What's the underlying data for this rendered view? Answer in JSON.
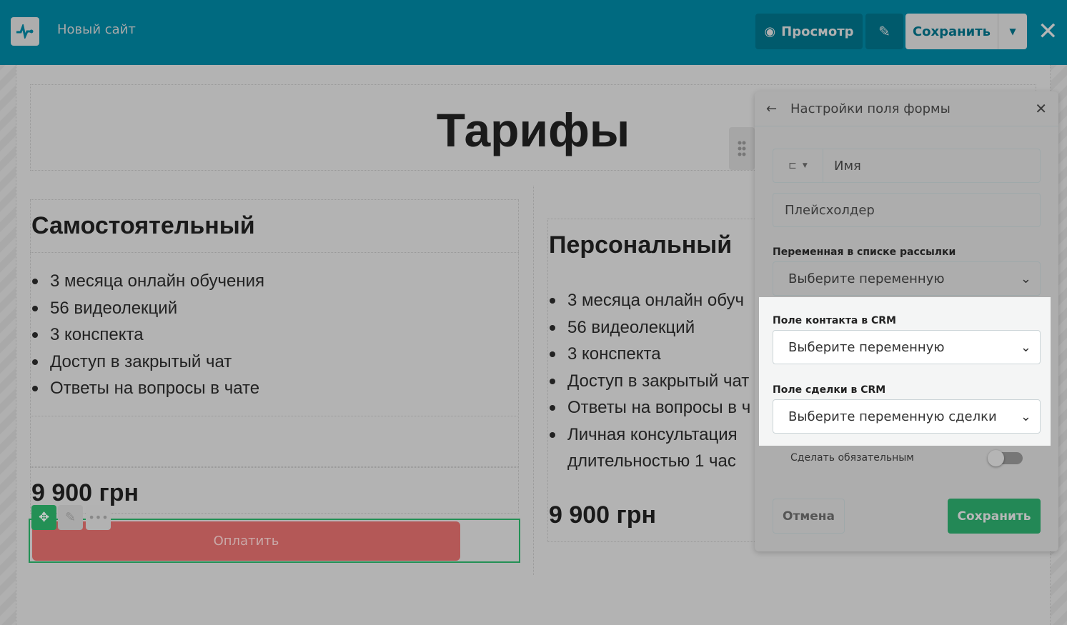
{
  "header": {
    "site_name": "Новый сайт",
    "preview_label": "Просмотр",
    "save_label": "Сохранить"
  },
  "page": {
    "title": "Тарифы",
    "plans": [
      {
        "name": "Самостоятельный",
        "features": [
          "3 месяца онлайн обучения",
          "56 видеолекций",
          "3 конспекта",
          "Доступ в закрытый чат",
          "Ответы на вопросы в чате"
        ],
        "price": "9 900 грн",
        "button": "Оплатить"
      },
      {
        "name": "Персональный",
        "features": [
          "3 месяца онлайн обуч",
          "56 видеолекций",
          "3 конспекта",
          "Доступ в закрытый чат",
          "Ответы на вопросы в ч",
          "Личная консультация длительностью 1 час"
        ],
        "price": "9 900 грн"
      }
    ]
  },
  "panel": {
    "title": "Настройки поля формы",
    "field_name": "Имя",
    "placeholder": "Плейсхолдер",
    "mailing_var_label": "Переменная в списке рассылки",
    "mailing_var_value": "Выберите переменную",
    "crm_contact_label": "Поле контакта в CRM",
    "crm_contact_value": "Выберите переменную",
    "crm_deal_label": "Поле сделки в CRM",
    "crm_deal_value": "Выберите переменную сделки",
    "required_label": "Сделать обязательным",
    "required": false,
    "cancel_label": "Отмена",
    "save_label": "Сохранить"
  }
}
